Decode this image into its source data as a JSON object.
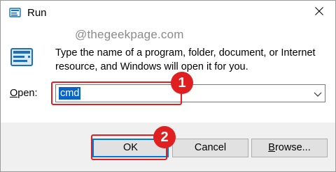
{
  "window": {
    "title": "Run",
    "title_icon": "run-app-icon",
    "close_icon": "close-icon"
  },
  "watermark": "@thegeekpage.com",
  "description": "Type the name of a program, folder, document, or Internet resource, and Windows will open it for you.",
  "open_label": {
    "accelerator": "O",
    "rest": "pen:"
  },
  "open_field": {
    "value": "cmd",
    "dropdown_icon": "chevron-down-icon"
  },
  "buttons": {
    "ok": "OK",
    "cancel": "Cancel",
    "browse_accelerator": "B",
    "browse_rest": "rowse..."
  },
  "annotations": {
    "step1": "1",
    "step2": "2",
    "color": "#e02020"
  },
  "colors": {
    "selection": "#0a64c8",
    "default_button_border": "#0078d7",
    "footer_bg": "#f0f0f0"
  }
}
